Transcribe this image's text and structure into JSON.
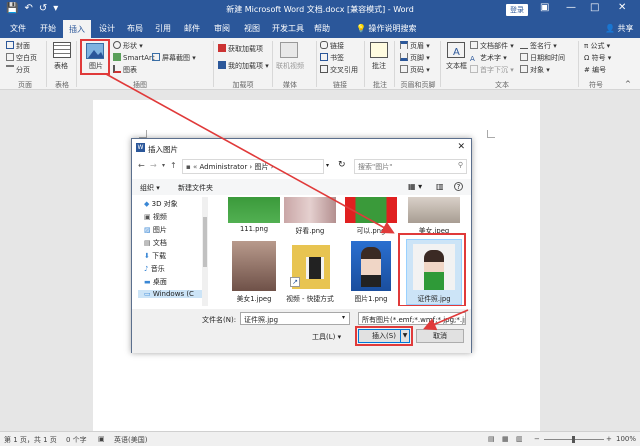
{
  "titlebar": {
    "title": "新建 Microsoft Word 文档.docx [兼容模式] - Word",
    "login": "登录",
    "quick_access": [
      "save-icon",
      "undo-icon",
      "redo-icon",
      "customize-icon"
    ]
  },
  "tabs": [
    "文件",
    "开始",
    "插入",
    "设计",
    "布局",
    "引用",
    "邮件",
    "审阅",
    "视图",
    "开发工具",
    "帮助"
  ],
  "active_tab": "插入",
  "tell_me": "操作说明搜索",
  "share": "共享",
  "ribbon": {
    "pages": {
      "cover": "封面",
      "blank": "空白页",
      "break": "分页",
      "group": "页面"
    },
    "table": {
      "label": "表格",
      "group": "表格"
    },
    "illustrations": {
      "picture": "图片",
      "shapes": "形状",
      "smartart": "SmartArt",
      "screenshot": "屏幕截图",
      "chart": "图表",
      "group": "插图"
    },
    "addins": {
      "get": "获取加载项",
      "my": "我的加载项",
      "group": "加载项"
    },
    "media": {
      "video": "联机视频",
      "group": "媒体"
    },
    "links": {
      "link": "链接",
      "bookmark": "书签",
      "crossref": "交叉引用",
      "group": "链接"
    },
    "comments": {
      "comment": "批注",
      "group": "批注"
    },
    "headerfooter": {
      "header": "页眉",
      "footer": "页脚",
      "pagenum": "页码",
      "group": "页眉和页脚"
    },
    "text": {
      "textbox": "文本框",
      "parts": "文档部件",
      "wordart": "艺术字",
      "dropcap": "首字下沉",
      "signature": "签名行",
      "datetime": "日期和时间",
      "object": "对象",
      "group": "文本"
    },
    "symbols": {
      "equation": "公式",
      "symbol": "符号",
      "number": "编号",
      "group": "符号"
    }
  },
  "dialog": {
    "title": "插入图片",
    "path": [
      "Administrator",
      "图片"
    ],
    "search_placeholder": "搜索\"图片\"",
    "organize": "组织 ▾",
    "new_folder": "新建文件夹",
    "nav": [
      "3D 对象",
      "视频",
      "图片",
      "文档",
      "下载",
      "音乐",
      "桌面",
      "Windows (C"
    ],
    "files_row1": [
      "111.png",
      "好看.png",
      "可以.png",
      "美女.jpeg"
    ],
    "files_row2": [
      "美女1.jpeg",
      "视频 - 快捷方式",
      "图片1.png",
      "证件照.jpg"
    ],
    "filename_label": "文件名(N):",
    "filename_value": "证件照.jpg",
    "filetype_value": "所有图片(*.emf;*.wmf;*.jpg;*.jp",
    "tools": "工具(L)",
    "insert": "插入(S)",
    "cancel": "取消"
  },
  "status": {
    "page": "第 1 页，共 1 页",
    "words": "0 个字",
    "language": "英语(美国)",
    "zoom": "100%"
  },
  "colors": {
    "brand": "#2b579a",
    "highlight": "#e03a3a",
    "selection": "#cce4f7"
  }
}
